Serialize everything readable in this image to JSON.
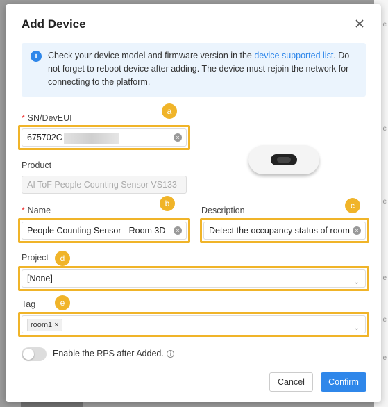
{
  "dialog": {
    "title": "Add Device",
    "info": {
      "text_before": "Check your device model and firmware version in the ",
      "link": "device supported list",
      "text_after": ". Do not forget to reboot device after adding. The device must rejoin the network for connecting to the platform."
    },
    "sn": {
      "required_mark": "*",
      "label": "SN/DevEUI",
      "value": "675702C"
    },
    "product": {
      "label": "Product",
      "value": "AI ToF People Counting Sensor VS133-"
    },
    "name": {
      "required_mark": "*",
      "label": "Name",
      "value": "People Counting Sensor - Room 3D"
    },
    "description": {
      "label": "Description",
      "value": "Detect the occupancy status of room"
    },
    "project": {
      "label": "Project",
      "value": "[None]"
    },
    "tag": {
      "label": "Tag",
      "chip": "room1"
    },
    "rps": {
      "label": "Enable the RPS after Added."
    },
    "buttons": {
      "cancel": "Cancel",
      "confirm": "Confirm"
    }
  },
  "markers": [
    "a",
    "b",
    "c",
    "d",
    "e"
  ]
}
